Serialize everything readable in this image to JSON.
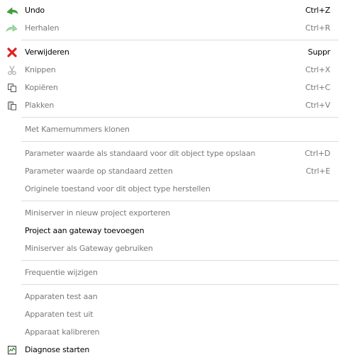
{
  "menu": {
    "items": [
      {
        "label": "Undo",
        "shortcut": "Ctrl+Z",
        "icon": "undo-arrow-icon",
        "enabled": true
      },
      {
        "label": "Herhalen",
        "shortcut": "Ctrl+R",
        "icon": "redo-arrow-icon",
        "enabled": false
      },
      {
        "label": "Verwijderen",
        "shortcut": "Suppr",
        "icon": "delete-x-icon",
        "enabled": true
      },
      {
        "label": "Knippen",
        "shortcut": "Ctrl+X",
        "icon": "scissors-icon",
        "enabled": false
      },
      {
        "label": "Kopiëren",
        "shortcut": "Ctrl+C",
        "icon": "copy-icon",
        "enabled": false
      },
      {
        "label": "Plakken",
        "shortcut": "Ctrl+V",
        "icon": "paste-icon",
        "enabled": false
      },
      {
        "label": "Met Kamernummers klonen",
        "shortcut": "",
        "enabled": false
      },
      {
        "label": "Parameter waarde als standaard voor dit object type opslaan",
        "shortcut": "Ctrl+D",
        "enabled": false
      },
      {
        "label": "Parameter waarde op standaard zetten",
        "shortcut": "Ctrl+E",
        "enabled": false
      },
      {
        "label": "Originele toestand voor dit object type herstellen",
        "shortcut": "",
        "enabled": false
      },
      {
        "label": "Miniserver in nieuw project exporteren",
        "shortcut": "",
        "enabled": false
      },
      {
        "label": "Project aan gateway toevoegen",
        "shortcut": "",
        "enabled": true
      },
      {
        "label": "Miniserver als Gateway gebruiken",
        "shortcut": "",
        "enabled": false
      },
      {
        "label": "Frequentie wijzigen",
        "shortcut": "",
        "enabled": false
      },
      {
        "label": "Apparaten test aan",
        "shortcut": "",
        "enabled": false
      },
      {
        "label": "Apparaten test uit",
        "shortcut": "",
        "enabled": false
      },
      {
        "label": "Apparaat kalibreren",
        "shortcut": "",
        "enabled": false
      },
      {
        "label": "Diagnose starten",
        "shortcut": "",
        "icon": "diagnose-chart-icon",
        "enabled": true
      }
    ]
  },
  "colors": {
    "enabled_text": "#000000",
    "disabled_text": "#7a7a7a",
    "separator": "#dcdcdc",
    "undo_green": "#3aa63a",
    "redo_green_light": "#9fd89f",
    "delete_red": "#e02020"
  }
}
